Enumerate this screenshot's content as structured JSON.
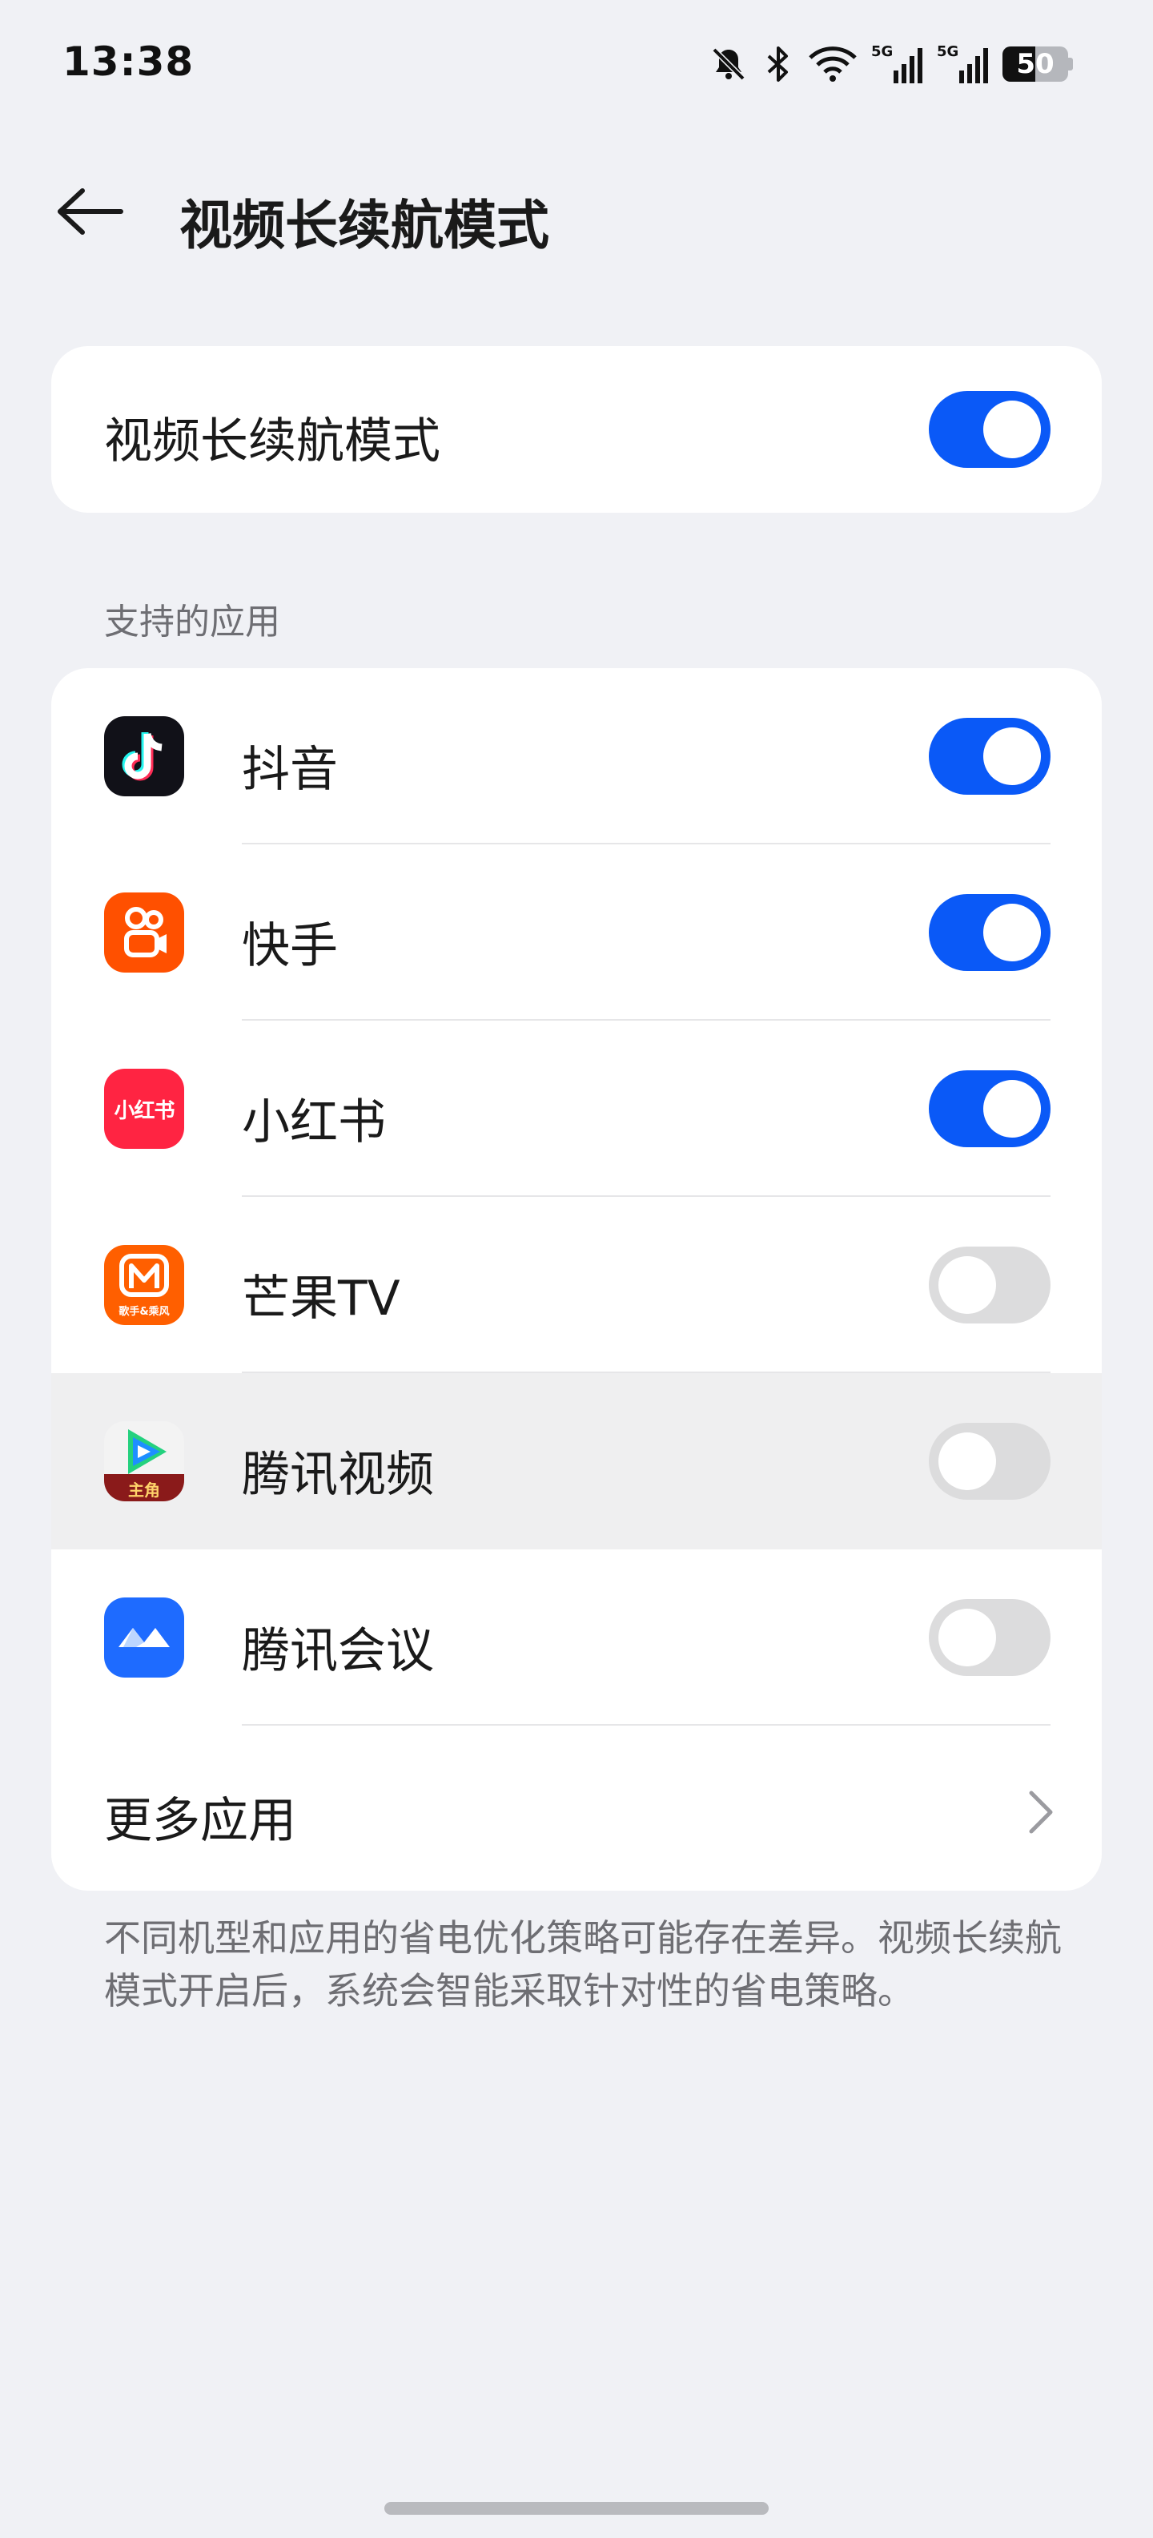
{
  "status_bar": {
    "time": "13:38",
    "icons": [
      "bell-muted-icon",
      "bluetooth-icon",
      "wifi-icon",
      "signal-5g-icon",
      "signal-5g-icon",
      "battery-icon"
    ],
    "signal_label_1": "5G",
    "signal_label_2": "5G",
    "battery_level": "50"
  },
  "header": {
    "back_icon": "arrow-left-icon",
    "title": "视频长续航模式"
  },
  "master_toggle": {
    "label": "视频长续航模式",
    "on": true
  },
  "apps_section": {
    "header": "支持的应用",
    "apps": [
      {
        "name": "抖音",
        "icon": "douyin-icon",
        "on": true
      },
      {
        "name": "快手",
        "icon": "kuaishou-icon",
        "on": true
      },
      {
        "name": "小红书",
        "icon": "xiaohongshu-icon",
        "icon_text": "小红书",
        "on": true
      },
      {
        "name": "芒果TV",
        "icon": "mangotv-icon",
        "icon_text": "歌手&乘风",
        "on": false
      },
      {
        "name": "腾讯视频",
        "icon": "tencent-video-icon",
        "icon_text": "主角",
        "on": false,
        "pressed": true
      },
      {
        "name": "腾讯会议",
        "icon": "tencent-meeting-icon",
        "on": false
      }
    ],
    "more_label": "更多应用",
    "more_icon": "chevron-right-icon"
  },
  "footnote": "不同机型和应用的省电优化策略可能存在差异。视频长续航模式开启后，系统会智能采取针对性的省电策略。",
  "colors": {
    "accent": "#0a59f7",
    "switch_off": "#dcdcdd",
    "background": "#f0f1f5",
    "secondary_text": "#6e6e73"
  }
}
